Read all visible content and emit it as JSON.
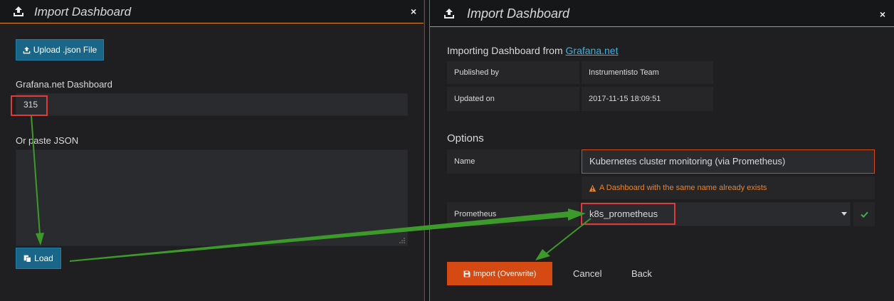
{
  "left_dialog": {
    "title": "Import Dashboard",
    "close_label": "×",
    "upload_button_label": "Upload .json File",
    "grafana_dashboard_label": "Grafana.net Dashboard",
    "grafana_dashboard_value": "315",
    "paste_json_label": "Or paste JSON",
    "paste_json_value": "",
    "load_button_label": "Load"
  },
  "right_dialog": {
    "title": "Import Dashboard",
    "close_label": "×",
    "importing_prefix": "Importing Dashboard from ",
    "importing_link": "Grafana.net",
    "info_rows": [
      {
        "label": "Published by",
        "value": "Instrumentisto Team"
      },
      {
        "label": "Updated on",
        "value": "2017-11-15 18:09:51"
      }
    ],
    "options_heading": "Options",
    "name_label": "Name",
    "name_value": "Kubernetes cluster monitoring (via Prometheus)",
    "name_warning": "A Dashboard with the same name already exists",
    "prometheus_label": "Prometheus",
    "prometheus_value": "k8s_prometheus",
    "import_button_label": "Import (Overwrite)",
    "cancel_label": "Cancel",
    "back_label": "Back"
  },
  "colors": {
    "accent_orange": "#e08a2b",
    "primary_blue": "#1a6689",
    "danger_red": "#d44a12",
    "annotation_red": "#e03a3a",
    "annotation_green": "#3c9a2a",
    "success_green": "#3fb04a",
    "warning_orange": "#e8842b"
  },
  "icons": {
    "header": "upload-tray-icon",
    "upload": "upload-icon",
    "load": "copy-icon",
    "warning": "warning-triangle-icon",
    "valid": "check-icon",
    "dropdown": "caret-down-icon",
    "import": "save-icon"
  }
}
